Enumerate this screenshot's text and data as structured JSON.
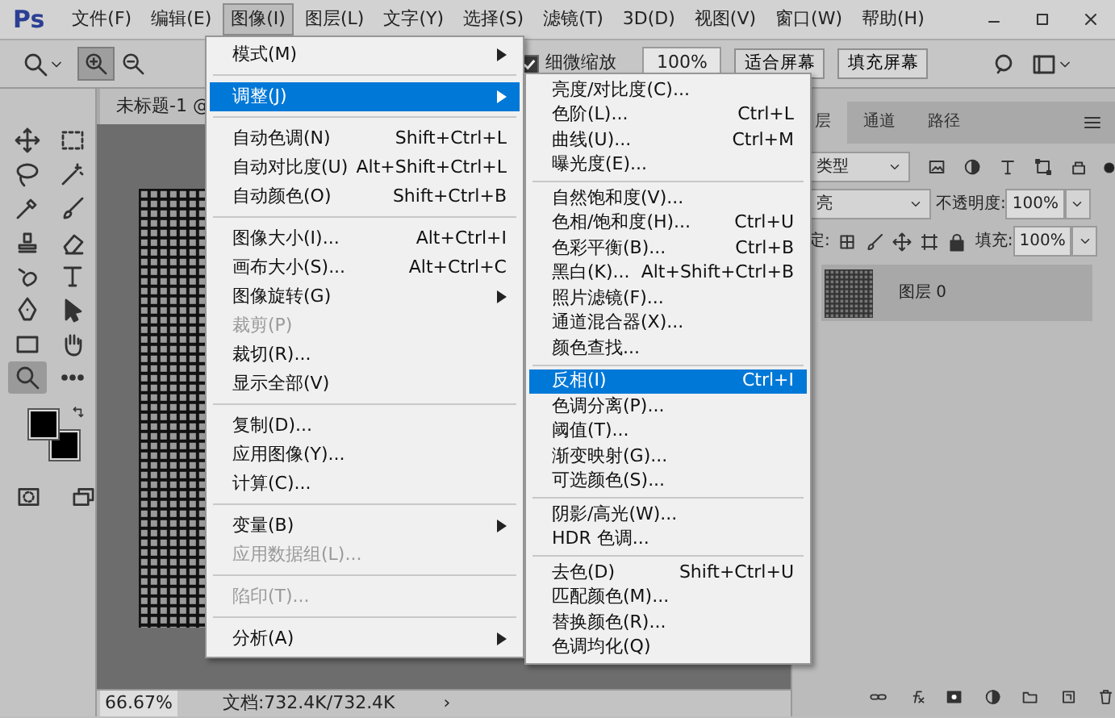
{
  "menubar": {
    "app_logo": "Ps",
    "menus": [
      {
        "label": "文件(F)",
        "selected": false
      },
      {
        "label": "编辑(E)",
        "selected": false
      },
      {
        "label": "图像(I)",
        "selected": true
      },
      {
        "label": "图层(L)",
        "selected": false
      },
      {
        "label": "文字(Y)",
        "selected": false
      },
      {
        "label": "选择(S)",
        "selected": false
      },
      {
        "label": "滤镜(T)",
        "selected": false
      },
      {
        "label": "3D(D)",
        "selected": false
      },
      {
        "label": "视图(V)",
        "selected": false
      },
      {
        "label": "窗口(W)",
        "selected": false
      },
      {
        "label": "帮助(H)",
        "selected": false
      }
    ]
  },
  "options_bar": {
    "zoom_modes": [
      {
        "selected": true
      },
      {
        "selected": false
      }
    ],
    "fine_zoom": {
      "label": "细微缩放",
      "checked": true
    },
    "zoom_value": "100%",
    "buttons": [
      "适合屏幕",
      "填充屏幕"
    ]
  },
  "toolbox": {
    "tools": [
      {
        "selected": false
      },
      {
        "selected": false
      },
      {
        "selected": false
      },
      {
        "selected": false
      },
      {
        "selected": false
      },
      {
        "selected": false
      },
      {
        "selected": false
      },
      {
        "selected": false
      },
      {
        "selected": false
      },
      {
        "selected": false
      },
      {
        "selected": false
      },
      {
        "selected": false
      },
      {
        "selected": false
      },
      {
        "selected": false
      },
      {
        "selected": true
      },
      {
        "selected": false
      }
    ]
  },
  "document": {
    "tab_title": "未标题-1 @",
    "status": {
      "zoom": "66.67%",
      "doc_size": "文档:732.4K/732.4K",
      "arrow": "›"
    }
  },
  "image_menu": {
    "items": [
      {
        "kind": "item",
        "label": "模式(M)",
        "submenu": true,
        "disabled": false,
        "selected": false
      },
      {
        "kind": "separator"
      },
      {
        "kind": "item",
        "label": "调整(J)",
        "submenu": true,
        "disabled": false,
        "selected": true
      },
      {
        "kind": "separator"
      },
      {
        "kind": "item",
        "label": "自动色调(N)",
        "shortcut": "Shift+Ctrl+L",
        "submenu": false,
        "disabled": false,
        "selected": false
      },
      {
        "kind": "item",
        "label": "自动对比度(U)",
        "shortcut": "Alt+Shift+Ctrl+L",
        "submenu": false,
        "disabled": false,
        "selected": false
      },
      {
        "kind": "item",
        "label": "自动颜色(O)",
        "shortcut": "Shift+Ctrl+B",
        "submenu": false,
        "disabled": false,
        "selected": false
      },
      {
        "kind": "separator"
      },
      {
        "kind": "item",
        "label": "图像大小(I)...",
        "shortcut": "Alt+Ctrl+I",
        "submenu": false,
        "disabled": false,
        "selected": false
      },
      {
        "kind": "item",
        "label": "画布大小(S)...",
        "shortcut": "Alt+Ctrl+C",
        "submenu": false,
        "disabled": false,
        "selected": false
      },
      {
        "kind": "item",
        "label": "图像旋转(G)",
        "submenu": true,
        "disabled": false,
        "selected": false
      },
      {
        "kind": "item",
        "label": "裁剪(P)",
        "submenu": false,
        "disabled": true,
        "selected": false
      },
      {
        "kind": "item",
        "label": "裁切(R)...",
        "submenu": false,
        "disabled": false,
        "selected": false
      },
      {
        "kind": "item",
        "label": "显示全部(V)",
        "submenu": false,
        "disabled": false,
        "selected": false
      },
      {
        "kind": "separator"
      },
      {
        "kind": "item",
        "label": "复制(D)...",
        "submenu": false,
        "disabled": false,
        "selected": false
      },
      {
        "kind": "item",
        "label": "应用图像(Y)...",
        "submenu": false,
        "disabled": false,
        "selected": false
      },
      {
        "kind": "item",
        "label": "计算(C)...",
        "submenu": false,
        "disabled": false,
        "selected": false
      },
      {
        "kind": "separator"
      },
      {
        "kind": "item",
        "label": "变量(B)",
        "submenu": true,
        "disabled": false,
        "selected": false
      },
      {
        "kind": "item",
        "label": "应用数据组(L)...",
        "submenu": false,
        "disabled": true,
        "selected": false
      },
      {
        "kind": "separator"
      },
      {
        "kind": "item",
        "label": "陷印(T)...",
        "submenu": false,
        "disabled": true,
        "selected": false
      },
      {
        "kind": "separator"
      },
      {
        "kind": "item",
        "label": "分析(A)",
        "submenu": true,
        "disabled": false,
        "selected": false
      }
    ]
  },
  "adjust_submenu": {
    "items": [
      {
        "kind": "item",
        "label": "亮度/对比度(C)...",
        "selected": false
      },
      {
        "kind": "item",
        "label": "色阶(L)...",
        "shortcut": "Ctrl+L",
        "selected": false
      },
      {
        "kind": "item",
        "label": "曲线(U)...",
        "shortcut": "Ctrl+M",
        "selected": false
      },
      {
        "kind": "item",
        "label": "曝光度(E)...",
        "selected": false
      },
      {
        "kind": "separator"
      },
      {
        "kind": "item",
        "label": "自然饱和度(V)...",
        "selected": false
      },
      {
        "kind": "item",
        "label": "色相/饱和度(H)...",
        "shortcut": "Ctrl+U",
        "selected": false
      },
      {
        "kind": "item",
        "label": "色彩平衡(B)...",
        "shortcut": "Ctrl+B",
        "selected": false
      },
      {
        "kind": "item",
        "label": "黑白(K)...",
        "shortcut": "Alt+Shift+Ctrl+B",
        "selected": false
      },
      {
        "kind": "item",
        "label": "照片滤镜(F)...",
        "selected": false
      },
      {
        "kind": "item",
        "label": "通道混合器(X)...",
        "selected": false
      },
      {
        "kind": "item",
        "label": "颜色查找...",
        "selected": false
      },
      {
        "kind": "separator"
      },
      {
        "kind": "item",
        "label": "反相(I)",
        "shortcut": "Ctrl+I",
        "selected": true
      },
      {
        "kind": "item",
        "label": "色调分离(P)...",
        "selected": false
      },
      {
        "kind": "item",
        "label": "阈值(T)...",
        "selected": false
      },
      {
        "kind": "item",
        "label": "渐变映射(G)...",
        "selected": false
      },
      {
        "kind": "item",
        "label": "可选颜色(S)...",
        "selected": false
      },
      {
        "kind": "separator"
      },
      {
        "kind": "item",
        "label": "阴影/高光(W)...",
        "selected": false
      },
      {
        "kind": "item",
        "label": "HDR 色调...",
        "selected": false
      },
      {
        "kind": "separator"
      },
      {
        "kind": "item",
        "label": "去色(D)",
        "shortcut": "Shift+Ctrl+U",
        "selected": false
      },
      {
        "kind": "item",
        "label": "匹配颜色(M)...",
        "selected": false
      },
      {
        "kind": "item",
        "label": "替换颜色(R)...",
        "selected": false
      },
      {
        "kind": "item",
        "label": "色调均化(Q)",
        "selected": false
      }
    ]
  },
  "layers_panel": {
    "tabs": [
      {
        "label": "层",
        "selected": true
      },
      {
        "label": "通道",
        "selected": false
      },
      {
        "label": "路径",
        "selected": false
      }
    ],
    "filter": "类型",
    "blend_mode": "亮",
    "opacity_label": "不透明度:",
    "opacity": "100%",
    "lock_label": "定:",
    "fill_label": "填充:",
    "fill": "100%",
    "layers": [
      {
        "name": "图层 0",
        "selected": true
      }
    ]
  }
}
